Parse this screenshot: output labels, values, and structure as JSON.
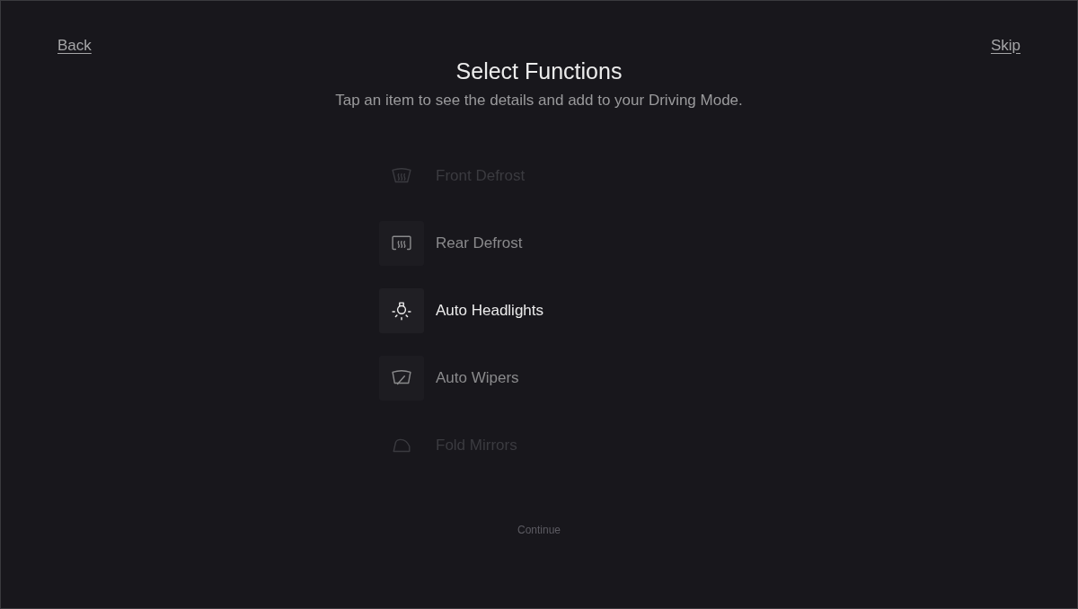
{
  "nav": {
    "back": "Back",
    "skip": "Skip"
  },
  "header": {
    "title": "Select Functions",
    "subtitle": "Tap an item to see the details and add to your Driving Mode."
  },
  "functions": [
    {
      "label": "Front Defrost",
      "selected": false,
      "faded": true
    },
    {
      "label": "Rear Defrost",
      "selected": false,
      "faded": false
    },
    {
      "label": "Auto Headlights",
      "selected": true,
      "faded": false
    },
    {
      "label": "Auto Wipers",
      "selected": false,
      "faded": false
    },
    {
      "label": "Fold Mirrors",
      "selected": false,
      "faded": true
    }
  ],
  "continue_button": {
    "label": "Continue",
    "disabled": true
  }
}
